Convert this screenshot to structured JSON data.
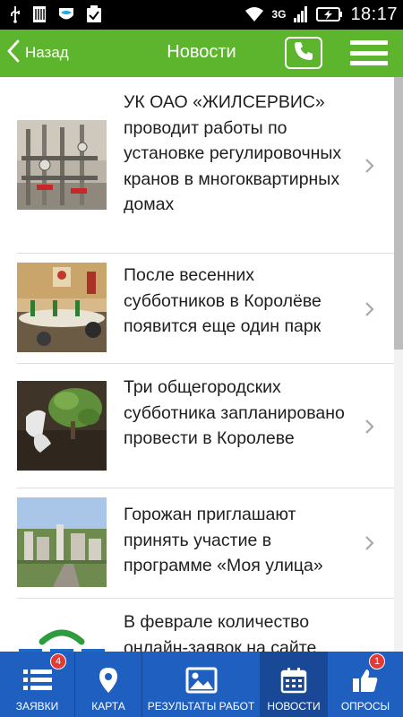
{
  "status_bar": {
    "network": "3G",
    "time": "18:17",
    "icons": [
      "usb-icon",
      "sim-icon",
      "shield-icon",
      "clipboard-icon",
      "wifi-icon",
      "signal-icon",
      "battery-icon"
    ]
  },
  "header": {
    "back_label": "Назад",
    "title": "Новости",
    "accent_color": "#5cb52d"
  },
  "news": [
    {
      "title": "УК ОАО «ЖИЛСЕРВИС» проводит работы по установке регулировочных кранов в многоквартирных домах",
      "image": "pipes-photo"
    },
    {
      "title": "После весенних субботников в Королёве появится еще один парк",
      "image": "meeting-photo"
    },
    {
      "title": "Три общегородских субботника запланировано провести в Королеве",
      "image": "planting-photo"
    },
    {
      "title": "Горожан приглашают принять участие в программе «Моя улица»",
      "image": "city-aerial-photo"
    },
    {
      "title": "В феврале количество онлайн-заявок на сайте",
      "image": "logo-image"
    }
  ],
  "bottom_nav": {
    "color": "#1f5fbf",
    "items": [
      {
        "label": "ЗАЯВКИ",
        "icon": "list-icon",
        "badge": "4"
      },
      {
        "label": "КАРТА",
        "icon": "map-pin-icon"
      },
      {
        "label": "РЕЗУЛЬТАТЫ РАБОТ",
        "icon": "image-icon"
      },
      {
        "label": "НОВОСТИ",
        "icon": "calendar-icon",
        "active": true
      },
      {
        "label": "ОПРОСЫ",
        "icon": "thumbs-up-icon",
        "badge": "1"
      }
    ]
  }
}
